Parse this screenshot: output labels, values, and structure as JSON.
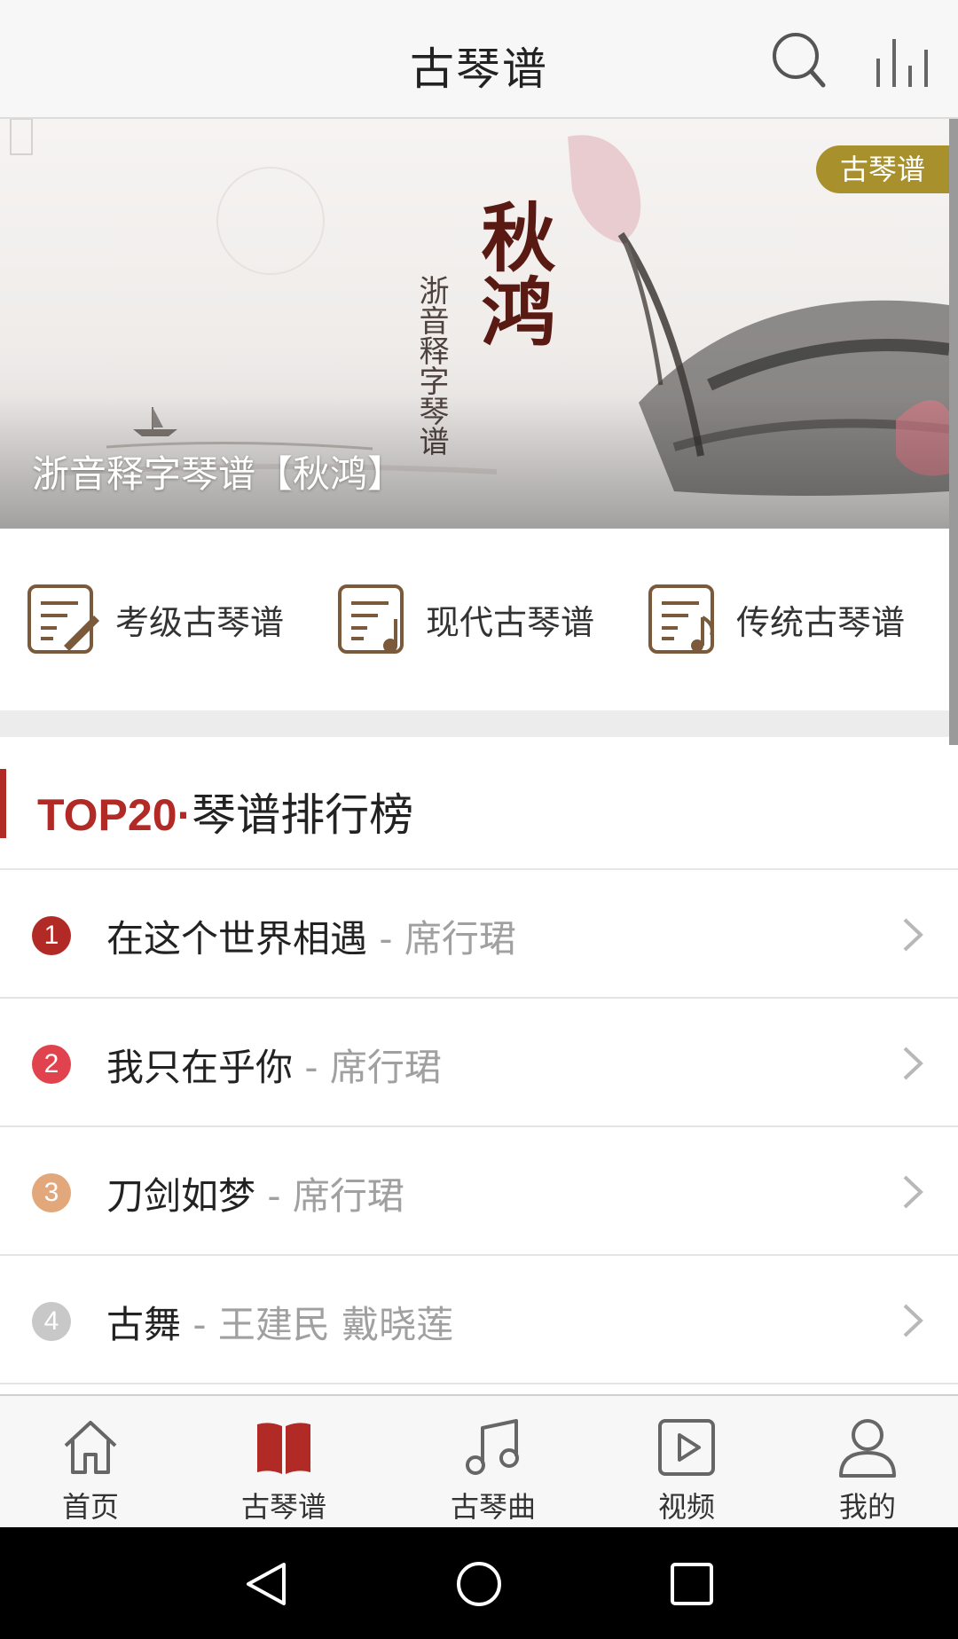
{
  "header": {
    "title": "古琴谱"
  },
  "banner": {
    "badge": "古琴谱",
    "caption": "浙音释字琴谱【秋鸿】",
    "calligraphy": "秋鸿",
    "subtitle_vertical": "浙音释字琴谱"
  },
  "categories": [
    {
      "label": "考级古琴谱",
      "icon": "score-pen-icon"
    },
    {
      "label": "现代古琴谱",
      "icon": "score-note-icon"
    },
    {
      "label": "传统古琴谱",
      "icon": "score-music-icon"
    }
  ],
  "ranking": {
    "title_prefix": "TOP20",
    "title_dot": "·",
    "title_rest": "琴谱排行榜",
    "items": [
      {
        "rank": "1",
        "title": "在这个世界相遇",
        "sep": " - ",
        "artist": "席行珺",
        "color": "#b22a25"
      },
      {
        "rank": "2",
        "title": "我只在乎你",
        "sep": " - ",
        "artist": "席行珺",
        "color": "#e0434e"
      },
      {
        "rank": "3",
        "title": "刀剑如梦",
        "sep": " - ",
        "artist": "席行珺",
        "color": "#e2a77a"
      },
      {
        "rank": "4",
        "title": "古舞",
        "sep": " - ",
        "artist": "王建民 戴晓莲",
        "color": "#c8c8c8"
      }
    ]
  },
  "bottom_nav": [
    {
      "label": "首页",
      "icon": "home-icon"
    },
    {
      "label": "古琴谱",
      "icon": "book-icon",
      "active": true
    },
    {
      "label": "古琴曲",
      "icon": "music-note-icon"
    },
    {
      "label": "视频",
      "icon": "video-icon"
    },
    {
      "label": "我的",
      "icon": "person-icon"
    }
  ],
  "colors": {
    "accent": "#b22a25",
    "badge_gold": "#a8902c",
    "category_brown": "#7a5a3a"
  }
}
